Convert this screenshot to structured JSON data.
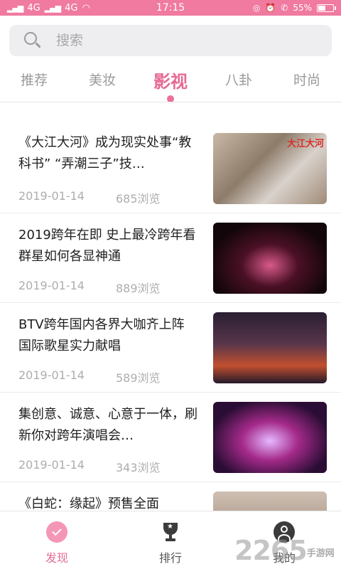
{
  "status_bar": {
    "signal_left": "4G",
    "signal_mid": "4G",
    "time": "17:15",
    "battery": "55%",
    "battery_level": 0.55,
    "icons": [
      "signal-icon",
      "wifi-icon",
      "headset-icon",
      "alarm-icon",
      "volte-icon",
      "battery-icon"
    ]
  },
  "search": {
    "placeholder": "搜索",
    "icon": "search-icon"
  },
  "tabs": [
    {
      "label": "推荐",
      "active": false
    },
    {
      "label": "美妆",
      "active": false
    },
    {
      "label": "影视",
      "active": true
    },
    {
      "label": "八卦",
      "active": false
    },
    {
      "label": "时尚",
      "active": false
    }
  ],
  "accent_color": "#e56a95",
  "articles": [
    {
      "title": "《大江大河》成为现实处事“教科书” “弄潮三子”技…",
      "date": "2019-01-14",
      "views": "685浏览",
      "thumb_caption": "大江大河"
    },
    {
      "title": "2019跨年在即 史上最冷跨年看群星如何各显神通",
      "date": "2019-01-14",
      "views": "889浏览",
      "thumb_caption": ""
    },
    {
      "title": "BTV跨年国内各界大咖齐上阵 国际歌星实力献唱",
      "date": "2019-01-14",
      "views": "589浏览",
      "thumb_caption": ""
    },
    {
      "title": "集创意、诚意、心意于一体，刷新你对跨年演唱会…",
      "date": "2019-01-14",
      "views": "343浏览",
      "thumb_caption": ""
    },
    {
      "title": "《白蛇：缘起》预售全面",
      "date": "",
      "views": "",
      "thumb_caption": ""
    }
  ],
  "bottom_nav": [
    {
      "label": "发现",
      "icon": "discover-icon",
      "active": true
    },
    {
      "label": "排行",
      "icon": "trophy-icon",
      "active": false
    },
    {
      "label": "我的",
      "icon": "profile-icon",
      "active": false
    }
  ],
  "watermark": {
    "text": "2265",
    "sub": "手游网"
  }
}
